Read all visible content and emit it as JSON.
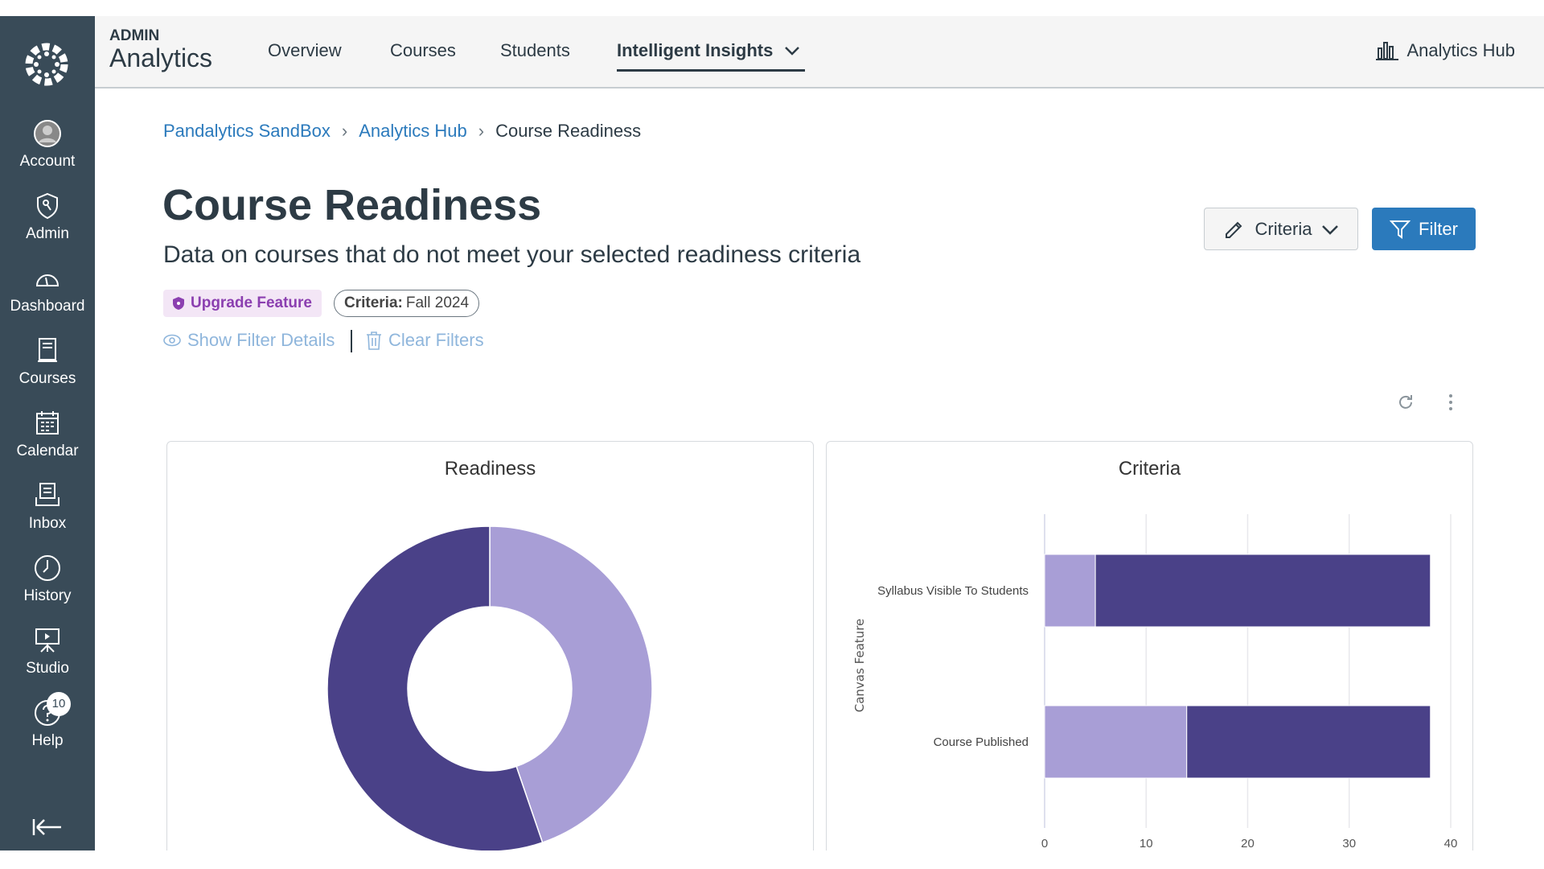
{
  "sidebar": {
    "items": [
      {
        "label": "Account",
        "icon": "account-icon"
      },
      {
        "label": "Admin",
        "icon": "admin-shield-icon"
      },
      {
        "label": "Dashboard",
        "icon": "dashboard-icon"
      },
      {
        "label": "Courses",
        "icon": "courses-icon"
      },
      {
        "label": "Calendar",
        "icon": "calendar-icon"
      },
      {
        "label": "Inbox",
        "icon": "inbox-icon"
      },
      {
        "label": "History",
        "icon": "history-clock-icon"
      },
      {
        "label": "Studio",
        "icon": "studio-icon"
      },
      {
        "label": "Help",
        "icon": "help-icon",
        "badge": "10"
      }
    ]
  },
  "header": {
    "brand_top": "ADMIN",
    "brand": "Analytics",
    "tabs": [
      "Overview",
      "Courses",
      "Students",
      "Intelligent Insights"
    ],
    "active_tab": "Intelligent Insights",
    "hub": "Analytics Hub"
  },
  "breadcrumb": [
    "Pandalytics SandBox",
    "Analytics Hub",
    "Course Readiness"
  ],
  "page": {
    "title": "Course Readiness",
    "subtitle": "Data on courses that do not meet your selected readiness criteria",
    "upgrade_badge": "Upgrade Feature",
    "criteria_label": "Criteria:",
    "criteria_value": "Fall 2024",
    "show_filter": "Show Filter Details",
    "clear_filters": "Clear Filters",
    "criteria_button": "Criteria",
    "filter_button": "Filter"
  },
  "colors": {
    "light": "#a89ed6",
    "dark": "#4a4188",
    "accent": "#2b7abc",
    "upgrade": "#8b3fb0"
  },
  "chart_data": [
    {
      "type": "pie",
      "title": "Readiness",
      "donut": true,
      "values": [
        17,
        21
      ],
      "colors": [
        "#a89ed6",
        "#4a4188"
      ]
    },
    {
      "type": "bar",
      "orientation": "horizontal",
      "stacked": true,
      "title": "Criteria",
      "ylabel": "Canvas Feature",
      "categories": [
        "Syllabus Visible To Students",
        "Course Published"
      ],
      "series": [
        {
          "values": [
            5,
            14
          ],
          "color": "#a89ed6"
        },
        {
          "values": [
            33,
            24
          ],
          "color": "#4a4188"
        }
      ],
      "xlim": [
        0,
        40
      ],
      "xticks": [
        "0",
        "10",
        "20",
        "30",
        "40"
      ],
      "grid": true
    }
  ]
}
